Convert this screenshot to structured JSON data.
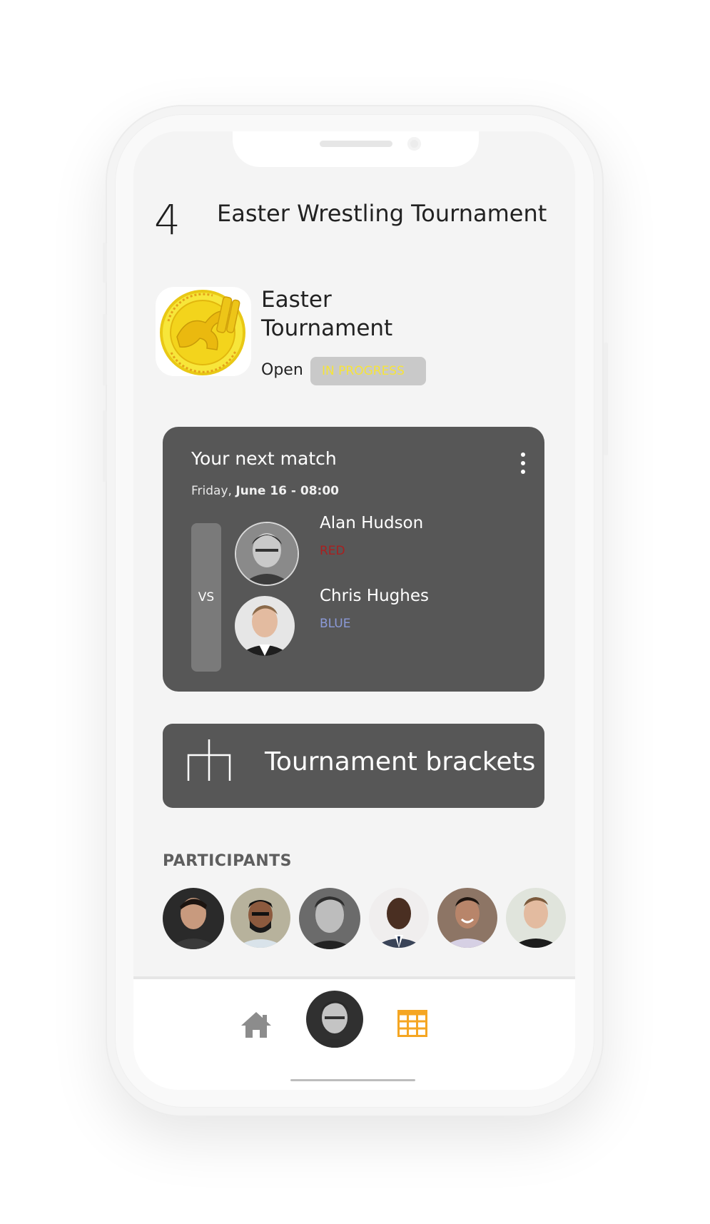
{
  "header": {
    "step_number": "4",
    "title": "Easter Wrestling Tournament"
  },
  "tournament": {
    "logo_icon": "tournament-logo-wrestler",
    "name": "Easter Tournament",
    "type": "Open",
    "status_badge": "IN PROGRESS"
  },
  "next_match": {
    "heading": "Your next match",
    "date_day": "Friday,",
    "date_time": "June 16 - 08:00",
    "vs_label": "VS",
    "fighters": [
      {
        "name": "Alan Hudson",
        "corner": "RED",
        "corner_color": "#b02020"
      },
      {
        "name": "Chris Hughes",
        "corner": "BLUE",
        "corner_color": "#8b9ad8"
      }
    ],
    "menu_icon": "more-vertical-icon"
  },
  "brackets": {
    "label": "Tournament brackets",
    "icon": "bracket-icon"
  },
  "participants": {
    "title": "PARTICIPANTS",
    "count_visible": 6
  },
  "tabbar": {
    "items": [
      {
        "icon": "home-icon",
        "active": false
      },
      {
        "icon": "profile-avatar",
        "active": false
      },
      {
        "icon": "table-grid-icon",
        "active": true
      }
    ],
    "active_color": "#f5a623"
  }
}
